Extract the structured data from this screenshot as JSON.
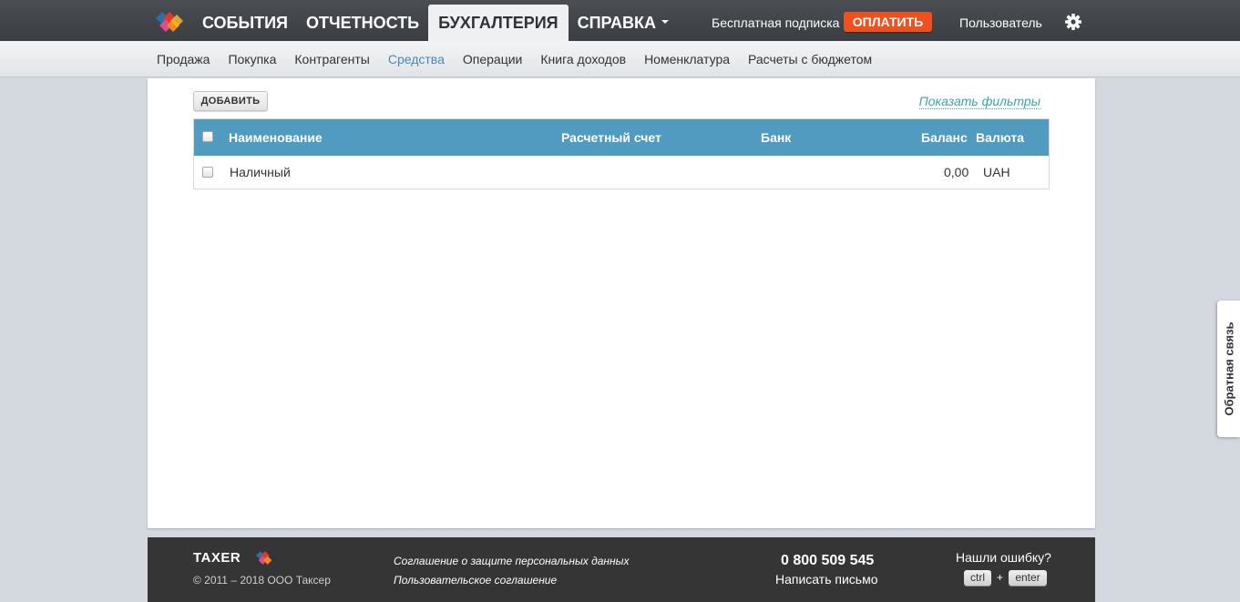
{
  "top_nav": {
    "items": [
      "СОБЫТИЯ",
      "ОТЧЕТНОСТЬ",
      "БУХГАЛТЕРИЯ",
      "СПРАВКА"
    ],
    "active": "БУХГАЛТЕРИЯ",
    "free_subscription": "Бесплатная подписка",
    "pay_button": "ОПЛАТИТЬ",
    "user": "Пользователь"
  },
  "sub_nav": {
    "items": [
      "Продажа",
      "Покупка",
      "Контрагенты",
      "Средства",
      "Операции",
      "Книга доходов",
      "Номенклатура",
      "Расчеты с бюджетом"
    ],
    "active": "Средства"
  },
  "toolbar": {
    "add_button": "ДОБАВИТЬ",
    "filters_link": "Показать фильтры"
  },
  "table": {
    "columns": [
      "Наименование",
      "Расчетный счет",
      "Банк",
      "Баланс",
      "Валюта"
    ],
    "rows": [
      {
        "name": "Наличный",
        "account": "",
        "bank": "",
        "balance": "0,00",
        "currency": "UAH"
      }
    ]
  },
  "feedback_tab": "Обратная связь",
  "footer": {
    "brand": "TAXER",
    "copyright": "© 2011 – 2018 ООО Таксер",
    "links": [
      "Соглашение о защите персональных данных",
      "Пользовательское соглашение"
    ],
    "phone": "0 800 509 545",
    "write": "Написать письмо",
    "bug_title": "Нашли ошибку?",
    "keys": [
      "ctrl",
      "enter"
    ],
    "plus": "+"
  },
  "colors": {
    "topbar": "#3f4246",
    "table_header": "#519ac0",
    "pay_button": "#f04f1e",
    "active_link": "#4a87b8",
    "filters_link": "#3fa3ab",
    "footer": "#353535"
  },
  "icons": [
    "taxer-logo-icon",
    "caret-down-icon",
    "gear-icon",
    "checkbox-icon"
  ]
}
